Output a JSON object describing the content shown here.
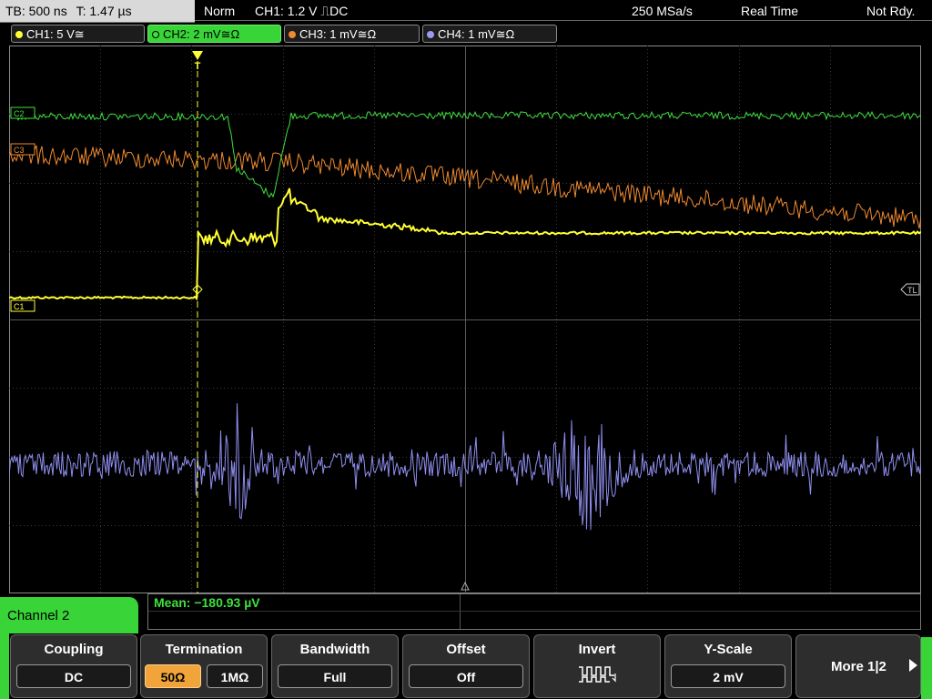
{
  "status": {
    "timebase": "TB: 500 ns",
    "trigger_time": "T: 1.47 µs",
    "mode": "Norm",
    "trigger": "CH1: 1.2 V ⎍DC",
    "samplerate": "250 MSa/s",
    "acq_mode": "Real Time",
    "state": "Not Rdy."
  },
  "channels": [
    {
      "label": "CH1: 5 V≅",
      "color": "#ffff33"
    },
    {
      "label": "CH2: 2 mV≅Ω",
      "color": "#3ee03e"
    },
    {
      "label": "CH3: 1 mV≅Ω",
      "color": "#f08a30"
    },
    {
      "label": "CH4: 1 mV≅Ω",
      "color": "#9a9af0"
    }
  ],
  "markers": {
    "ch2": "C2",
    "ch3": "C3",
    "ch1": "C1",
    "trigger_level": "TL",
    "trigger_pos": "T"
  },
  "measurement": {
    "text": "Mean: −180.93 µV"
  },
  "menu": {
    "title": "Channel 2",
    "coupling": {
      "label": "Coupling",
      "value": "DC"
    },
    "termination": {
      "label": "Termination",
      "opt1": "50Ω",
      "opt2": "1MΩ"
    },
    "bandwidth": {
      "label": "Bandwidth",
      "value": "Full"
    },
    "offset": {
      "label": "Offset",
      "value": "Off"
    },
    "invert": {
      "label": "Invert",
      "icon": "invert-waveform-icon"
    },
    "yscale": {
      "label": "Y-Scale",
      "value": "2 mV"
    },
    "more": "More 1|2"
  }
}
